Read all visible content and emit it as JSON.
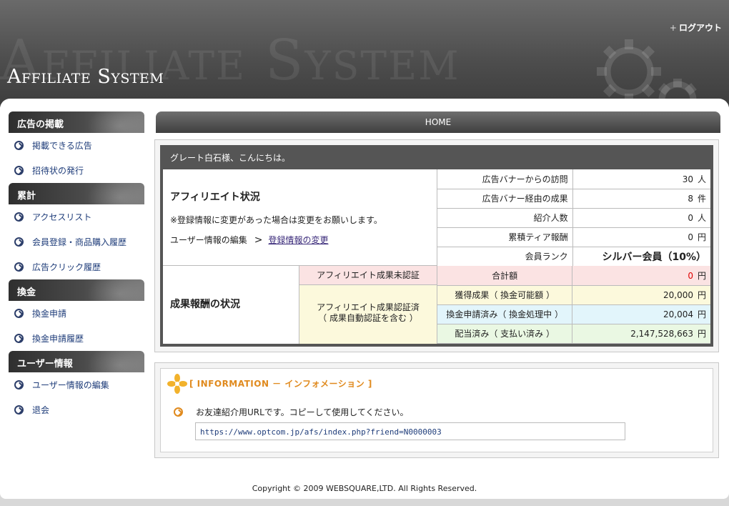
{
  "header": {
    "logo": "Affiliate System",
    "watermark": "Affiliate System",
    "logout": "ログアウト",
    "logout_plus": "+"
  },
  "sidebar": {
    "sections": [
      {
        "title": "広告の掲載",
        "items": [
          "掲載できる広告",
          "招待状の発行"
        ]
      },
      {
        "title": "累計",
        "items": [
          "アクセスリスト",
          "会員登録・商品購入履歴",
          "広告クリック履歴"
        ]
      },
      {
        "title": "換金",
        "items": [
          "換金申請",
          "換金申請履歴"
        ]
      },
      {
        "title": "ユーザー情報",
        "items": [
          "ユーザー情報の編集",
          "退会"
        ]
      }
    ]
  },
  "main": {
    "page_title": "HOME",
    "greeting": "グレート白石様、こんにちは。",
    "affiliate": {
      "title": "アフィリエイト状況",
      "note": "※登録情報に変更があった場合は変更をお願いします。",
      "edit_label": "ユーザー情報の編集",
      "separator": ">",
      "change_link": "登録情報の変更"
    },
    "stats": [
      {
        "label": "広告バナーからの訪問",
        "value": "30",
        "unit": "人"
      },
      {
        "label": "広告バナー経由の成果",
        "value": "8",
        "unit": "件"
      },
      {
        "label": "紹介人数",
        "value": "0",
        "unit": "人"
      },
      {
        "label": "累積ティア報酬",
        "value": "0",
        "unit": "円"
      },
      {
        "label": "会員ランク",
        "value": "シルバー会員（10%）",
        "unit": ""
      }
    ],
    "rewards": {
      "title": "成果報酬の状況",
      "unconfirmed_label": "アフィリエイト成果未認証",
      "confirmed_label_1": "アフィリエイト成果認証済",
      "confirmed_label_2": "（ 成果自動認証を含む ）",
      "rows": [
        {
          "label": "合計額",
          "value": "0",
          "unit": "円"
        },
        {
          "label": "獲得成果（ 換金可能額 ）",
          "value": "20,000",
          "unit": "円"
        },
        {
          "label": "換金申請済み（ 換金処理中 ）",
          "value": "20,004",
          "unit": "円"
        },
        {
          "label": "配当済み（ 支払い済み ）",
          "value": "2,147,528,663",
          "unit": "円"
        }
      ]
    },
    "information": {
      "title": "[ INFORMATION － インフォメーション ]",
      "message": "お友達紹介用URLです。コピーして使用してください。",
      "url": "https://www.optcom.jp/afs/index.php?friend=N0000003"
    }
  },
  "footer": {
    "copyright": "Copyright © 2009 WEBSQUARE,LTD. All Rights Reserved."
  },
  "colors": {
    "accent_orange": "#e08a1e",
    "link_blue": "#1f3d7a",
    "header_dark": "#4e4e4e"
  }
}
